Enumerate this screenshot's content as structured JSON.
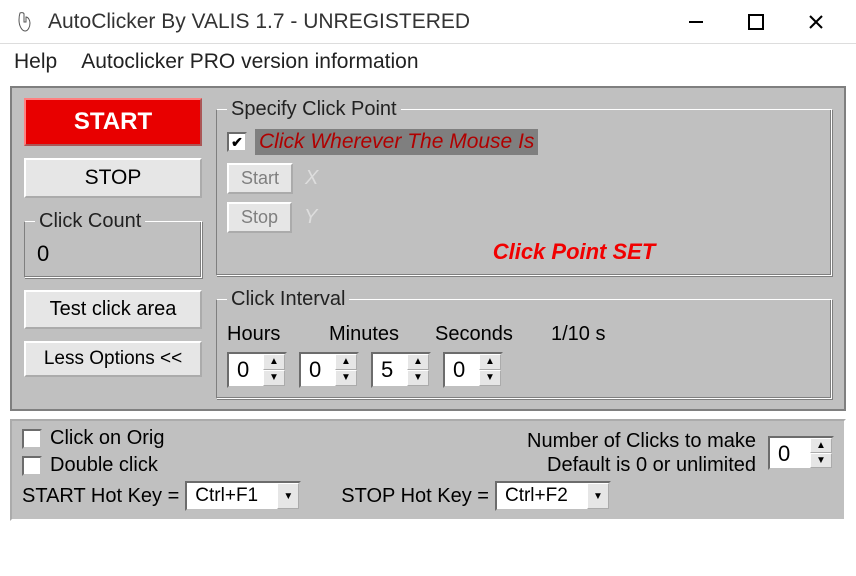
{
  "window": {
    "title": "AutoClicker By VALIS 1.7 - UNREGISTERED"
  },
  "menu": {
    "help": "Help",
    "pro_info": "Autoclicker PRO version information"
  },
  "buttons": {
    "start": "START",
    "stop": "STOP",
    "test_area": "Test click area",
    "less_options": "Less Options <<"
  },
  "click_count": {
    "legend": "Click Count",
    "value": "0"
  },
  "specify": {
    "legend": "Specify Click Point",
    "cb_checked": true,
    "cb_label": "Click Wherever The Mouse Is",
    "start_btn": "Start",
    "stop_btn": "Stop",
    "x_label": "X",
    "y_label": "Y",
    "status": "Click Point SET"
  },
  "interval": {
    "legend": "Click Interval",
    "labels": {
      "h": "Hours",
      "m": "Minutes",
      "s": "Seconds",
      "t": "1/10 s"
    },
    "values": {
      "h": "0",
      "m": "0",
      "s": "5",
      "t": "0"
    }
  },
  "options": {
    "click_on_orig": "Click on Orig",
    "double_click": "Double click",
    "start_hotkey_label": "START Hot Key =",
    "start_hotkey_value": "Ctrl+F1",
    "stop_hotkey_label": "STOP Hot Key =",
    "stop_hotkey_value": "Ctrl+F2",
    "num_clicks_label": "Number of Clicks to make",
    "num_clicks_sub": "Default is 0 or unlimited",
    "num_clicks_value": "0"
  }
}
